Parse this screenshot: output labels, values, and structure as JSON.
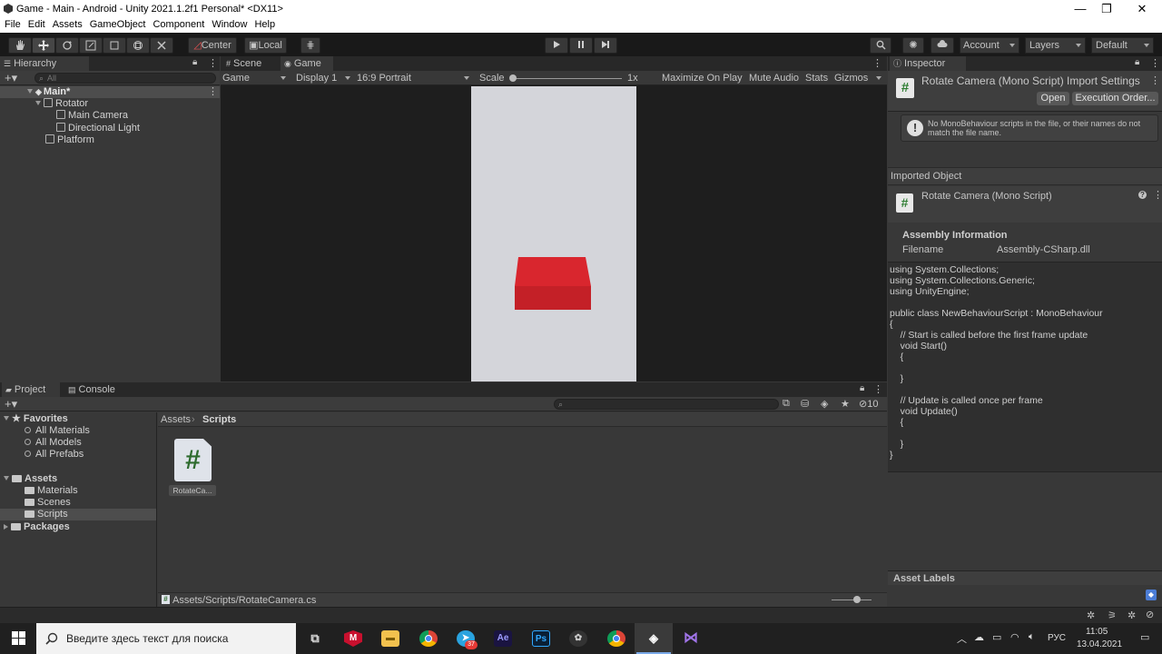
{
  "window": {
    "title": "Game - Main - Android - Unity 2021.1.2f1 Personal* <DX11>"
  },
  "menu": [
    "File",
    "Edit",
    "Assets",
    "GameObject",
    "Component",
    "Window",
    "Help"
  ],
  "toolbar": {
    "center_label": "Center",
    "local_label": "Local",
    "account_label": "Account",
    "layers_label": "Layers",
    "layout_label": "Default"
  },
  "hierarchy": {
    "tab": "Hierarchy",
    "search_placeholder": "All",
    "items": [
      {
        "label": "Main*",
        "depth": 0
      },
      {
        "label": "Rotator",
        "depth": 1
      },
      {
        "label": "Main Camera",
        "depth": 2
      },
      {
        "label": "Directional Light",
        "depth": 2
      },
      {
        "label": "Platform",
        "depth": 1
      }
    ]
  },
  "scene_tabs": {
    "scene": "Scene",
    "game": "Game"
  },
  "game_bar": {
    "display_mode": "Game",
    "display": "Display 1",
    "aspect": "16:9 Portrait",
    "scale_label": "Scale",
    "scale_value": "1x",
    "maximize": "Maximize On Play",
    "mute": "Mute Audio",
    "stats": "Stats",
    "gizmos": "Gizmos"
  },
  "inspector": {
    "tab": "Inspector",
    "header_title": "Rotate Camera (Mono Script) Import Settings",
    "open_btn": "Open",
    "exec_btn": "Execution Order...",
    "warning": "No MonoBehaviour scripts in the file, or their names do not match the file name.",
    "imported_object": "Imported Object",
    "object_title": "Rotate Camera (Mono Script)",
    "assembly_heading": "Assembly Information",
    "filename_label": "Filename",
    "filename_value": "Assembly-CSharp.dll",
    "code_lines": [
      "using System.Collections;",
      "using System.Collections.Generic;",
      "using UnityEngine;",
      "",
      "public class NewBehaviourScript : MonoBehaviour",
      "{",
      "    // Start is called before the first frame update",
      "    void Start()",
      "    {",
      "",
      "    }",
      "",
      "    // Update is called once per frame",
      "    void Update()",
      "    {",
      "",
      "    }",
      "}"
    ],
    "asset_labels": "Asset Labels"
  },
  "project": {
    "tab_project": "Project",
    "tab_console": "Console",
    "hidden_count": "10",
    "favorites": "Favorites",
    "fav_items": [
      "All Materials",
      "All Models",
      "All Prefabs"
    ],
    "assets": "Assets",
    "asset_folders": [
      "Materials",
      "Scenes",
      "Scripts"
    ],
    "packages": "Packages",
    "breadcrumb_root": "Assets",
    "breadcrumb_current": "Scripts",
    "file_name": "RotateCa...",
    "status_path": "Assets/Scripts/RotateCamera.cs"
  },
  "taskbar": {
    "search_placeholder": "Введите здесь текст для поиска",
    "lang": "РУС",
    "time": "11:05",
    "date": "13.04.2021",
    "telegram_badge": "37"
  },
  "colors": {
    "accent": "#4c7dd6",
    "cube": "#d42a30",
    "game_bg": "#d4d5da"
  }
}
